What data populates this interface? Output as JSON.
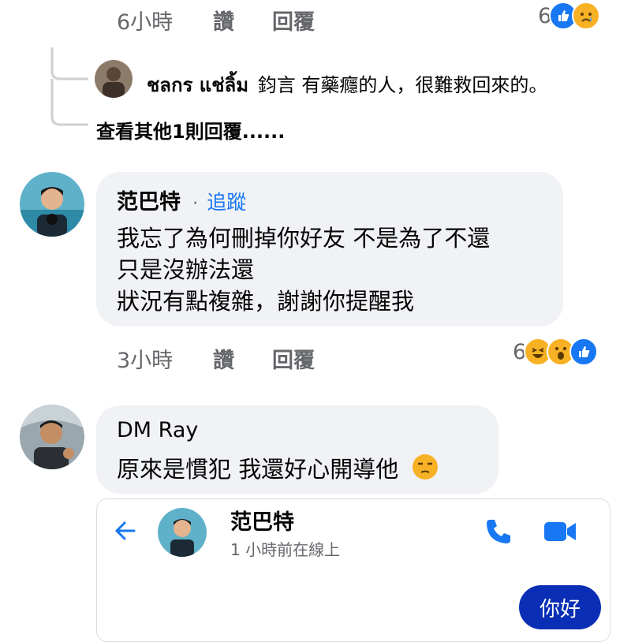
{
  "top_comment": {
    "time": "6小時",
    "like": "讚",
    "reply": "回覆",
    "reaction_count": "6"
  },
  "reply_preview": {
    "author": "ชลกร แช่ลิ้ม",
    "text": "鈞言 有藥癮的人，很難救回來的。",
    "view_more": "查看其他1則回覆......"
  },
  "comment1": {
    "author": "范巴特",
    "separator": "·",
    "follow": "追蹤",
    "lines": [
      "我忘了為何刪掉你好友 不是為了不還",
      "只是沒辦法還",
      "狀況有點複雜，謝謝你提醒我"
    ],
    "time": "3小時",
    "like": "讚",
    "reply": "回覆",
    "reaction_count": "6"
  },
  "comment2": {
    "author": "DM Ray",
    "text": "原來是慣犯 我還好心開導他"
  },
  "messenger": {
    "contact_name": "范巴特",
    "status": "1 小時前在線上",
    "message": "你好"
  },
  "colors": {
    "accent": "#1877f2",
    "bubble": "#f0f2f5",
    "messenger_bubble": "#0a2fb6"
  }
}
